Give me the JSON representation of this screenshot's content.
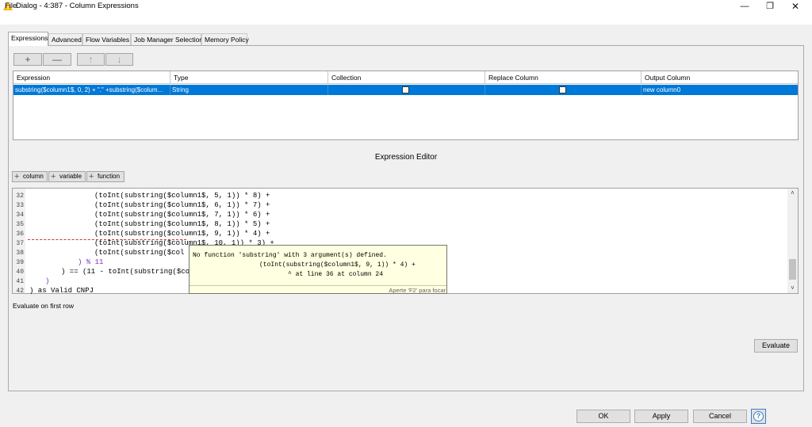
{
  "window": {
    "title": "Dialog - 4:387 - Column Expressions",
    "minimize_glyph": "—",
    "maximize_glyph": "❐",
    "close_glyph": "✕"
  },
  "menu": {
    "file": "File"
  },
  "tabs": [
    {
      "label": "Expressions",
      "active": true
    },
    {
      "label": "Advanced"
    },
    {
      "label": "Flow Variables"
    },
    {
      "label": "Job Manager Selection"
    },
    {
      "label": "Memory Policy"
    }
  ],
  "toolbar": {
    "add": "+",
    "remove": "—",
    "up": "↑",
    "down": "↓"
  },
  "table": {
    "headers": [
      "Expression",
      "Type",
      "Collection",
      "Replace Column",
      "Output Column"
    ],
    "rows": [
      {
        "expression": "substring($column1$, 0, 2) + \".\" +substring($colum...",
        "type": "String",
        "collection": false,
        "replace_column": false,
        "output_column": "new column0"
      }
    ]
  },
  "editor": {
    "heading": "Expression Editor",
    "insert_buttons": {
      "column": "column",
      "variable": "variable",
      "function": "function"
    },
    "line_numbers": [
      "32",
      "33",
      "34",
      "35",
      "36",
      "37",
      "38",
      "39",
      "40",
      "41",
      "42"
    ],
    "lines": [
      "(toInt(substring($column1$, 5, 1)) * 8) +",
      "(toInt(substring($column1$, 6, 1)) * 7) +",
      "(toInt(substring($column1$, 7, 1)) * 6) +",
      "(toInt(substring($column1$, 8, 1)) * 5) +",
      "(toInt(substring($column1$, 9, 1)) * 4) +",
      "(toInt(substring($column1$, 10, 1)) * 3) +",
      "(toInt(substring($col",
      ") % 11",
      ") == (11 - toInt(substring($col",
      ")",
      ") as Valid CNPJ"
    ],
    "tooltip": {
      "line1": "No function 'substring' with 3 argument(s) defined.",
      "line2": "(toInt(substring($column1$, 9, 1)) * 4) +",
      "line3": "^ at line 36 at column 24",
      "hint": "Aperte 'F2' para focar"
    },
    "evaluate_on_first_row": "Evaluate on first row",
    "evaluate_button": "Evaluate"
  },
  "footer": {
    "ok": "OK",
    "apply": "Apply",
    "cancel": "Cancel",
    "help": "?"
  },
  "colors": {
    "selection": "#0078d7",
    "warning": "#f2b600",
    "keyword": "#7a2dbb",
    "error": "#e03030"
  },
  "icons": [
    "warning-icon",
    "minimize-icon",
    "maximize-icon",
    "close-icon",
    "plus-icon",
    "minus-icon",
    "arrow-up-icon",
    "arrow-down-icon",
    "help-icon"
  ]
}
